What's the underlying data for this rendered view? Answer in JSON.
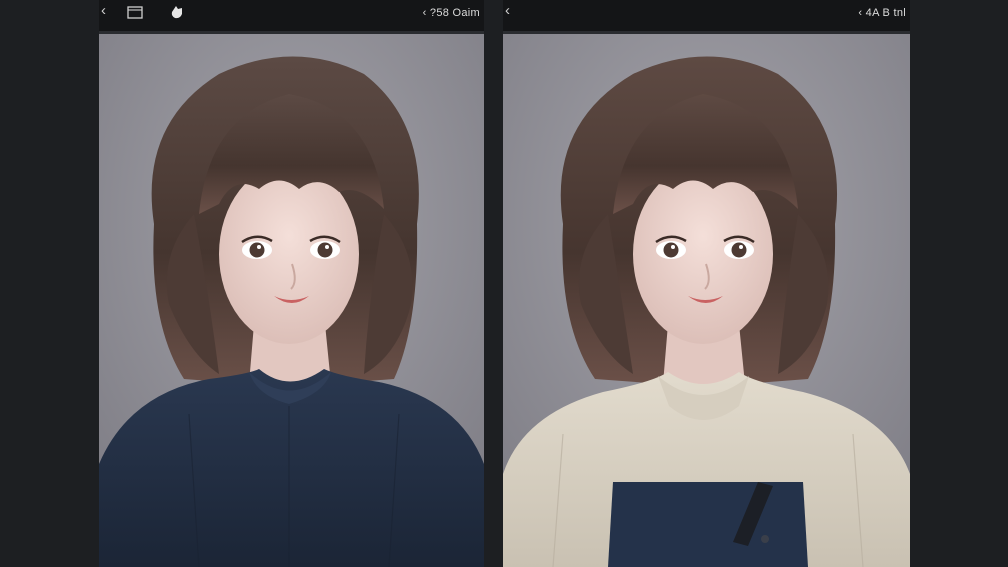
{
  "left_screen": {
    "status_text": "‹ ?58 Oaim"
  },
  "right_screen": {
    "status_text": "‹ 4A B tnl"
  },
  "icons": {
    "back": "chevron-left-icon",
    "gallery": "gallery-icon",
    "hand": "hand-pointer-icon",
    "signal": "signal-icon"
  },
  "colors": {
    "background": "#1d1f22",
    "backdrop": "#8d8c93",
    "hair": "#4a3a34",
    "sweater_navy": "#233044",
    "sweater_cream": "#d9d1c3"
  }
}
